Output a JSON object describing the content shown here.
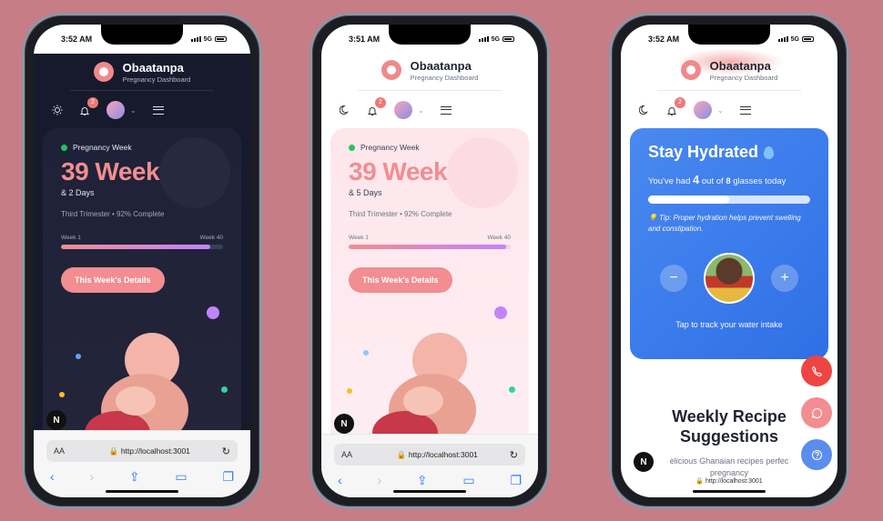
{
  "phones": [
    {
      "time": "3:52 AM",
      "network": "5G",
      "app_name": "Obaatanpa",
      "app_subtitle": "Pregnancy Dashboard",
      "notifications": "2",
      "week_label": "Pregnancy Week",
      "weeks": "39 Weeks",
      "days": "& 2 Days",
      "trimester": "Third Trimester • 92% Complete",
      "progress_start": "Week 1",
      "progress_end": "Week 40",
      "progress_percent": 92,
      "details_button": "This Week's Details",
      "url": "http://localhost:3001",
      "aa": "AA",
      "n_badge": "N"
    },
    {
      "time": "3:51 AM",
      "network": "5G",
      "app_name": "Obaatanpa",
      "app_subtitle": "Pregnancy Dashboard",
      "notifications": "2",
      "week_label": "Pregnancy Week",
      "weeks": "39 Weeks",
      "days": "& 5 Days",
      "trimester": "Third Trimester • 92% Complete",
      "progress_start": "Week 1",
      "progress_end": "Week 40",
      "progress_percent": 97,
      "details_button": "This Week's Details",
      "url": "http://localhost:3001",
      "aa": "AA",
      "n_badge": "N"
    },
    {
      "time": "3:52 AM",
      "network": "5G",
      "app_name": "Obaatanpa",
      "app_subtitle": "Pregnancy Dashboard",
      "notifications": "2",
      "hydration_title": "Stay Hydrated",
      "hydration_prefix": "You've had ",
      "glasses_had": "4",
      "hydration_mid": " out of ",
      "glasses_total": "8",
      "hydration_suffix": " glasses today",
      "hydration_fraction": 0.5,
      "tip": "💡 Tip: Proper hydration helps prevent swelling and constipation.",
      "tap_text": "Tap to track your water intake",
      "minus": "−",
      "plus": "+",
      "recipe_title_1": "Weekly Recipe",
      "recipe_title_2": "Suggestions",
      "recipe_sub_1": "elicious Ghanaian recipes perfec",
      "recipe_sub_2": "pregnancy",
      "url": "http://localhost:3001",
      "n_badge": "N"
    }
  ],
  "colors": {
    "accent": "#f28d91",
    "background": "#c77d86",
    "hydration_blue": "#2f6fe6",
    "fab_call": "#ef4444",
    "fab_chat": "#f28d91",
    "fab_help": "#5b8def"
  },
  "icons": [
    "sun-icon",
    "moon-icon",
    "bell-icon",
    "chevron-down-icon",
    "menu-icon",
    "lock-icon",
    "reload-icon",
    "back-icon",
    "forward-icon",
    "share-icon",
    "book-icon",
    "tabs-icon",
    "phone-icon",
    "chat-icon",
    "help-icon",
    "water-drop-icon"
  ]
}
